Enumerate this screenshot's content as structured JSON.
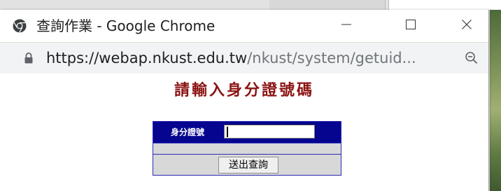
{
  "window": {
    "title": "查詢作業 - Google Chrome",
    "app_icon": "chrome-icon",
    "controls": {
      "minimize": "minimize-icon",
      "maximize": "maximize-icon",
      "close": "close-icon"
    }
  },
  "address_bar": {
    "lock_icon": "lock-icon",
    "url_host": "https://webap.nkust.edu.tw",
    "url_path": "/nkust/system/getuid...",
    "zoom_icon": "zoom-icon"
  },
  "page": {
    "heading": "請輸入身分證號碼",
    "form": {
      "id_label": "身分證號",
      "id_value": "",
      "submit_label": "送出查詢"
    }
  },
  "colors": {
    "heading": "#8b1212",
    "form_header_bg": "#050590",
    "form_border": "#2b2bb3",
    "form_row_bg": "#d8d8d8"
  }
}
